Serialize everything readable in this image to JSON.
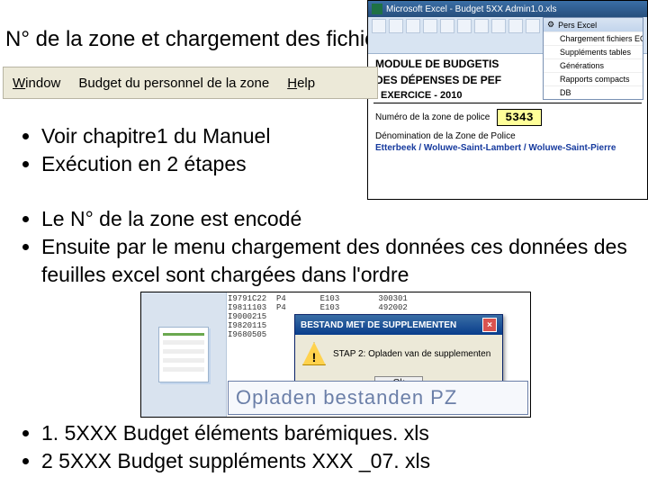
{
  "title": "N° de la zone et chargement des fichiers",
  "topfig": {
    "excel_title": "Microsoft Excel - Budget 5XX Admin1.0.xls",
    "menu_head": "Pers Excel",
    "menu_items": [
      "Chargement fichiers EOP",
      "Suppléments tables",
      "Générations",
      "Rapports compacts",
      "DB"
    ],
    "module_line1": "MODULE DE BUDGETIS",
    "module_line2": "DES DÉPENSES DE PEF",
    "exercice": "EXERCICE - 2010",
    "num_label": "Numéro de la zone de police",
    "num_value": "5343",
    "denom_label": "Dénomination de la Zone de Police",
    "denom_value": "Etterbeek / Woluwe-Saint-Lambert / Woluwe-Saint-Pierre"
  },
  "menubar": {
    "window": "Window",
    "budget": "Budget du personnel de la zone",
    "help": "Help"
  },
  "bullets1": [
    "Voir chapitre1 du Manuel",
    "Exécution en  2 étapes"
  ],
  "bullets2": [
    "Le N° de la zone est encodé",
    "Ensuite par le menu chargement des données ces données des feuilles excel sont chargées dans l'ordre"
  ],
  "bullets3": [
    "1. 5XXX Budget éléments barémiques. xls",
    "2 5XXX Budget suppléments XXX _07. xls"
  ],
  "fig2": {
    "rows": [
      "I9791C22  P4       E103        300301",
      "I9811103  P4       E103        492002",
      "I9000215                       ",
      "I9820115                       ",
      "I9680505                       "
    ],
    "msg_title": "BESTAND MET DE SUPPLEMENTEN",
    "msg_text": "STAP 2: Opladen van de supplementen",
    "ok_label": "Ok",
    "pz_placeholder": "Opladen bestanden PZ"
  }
}
